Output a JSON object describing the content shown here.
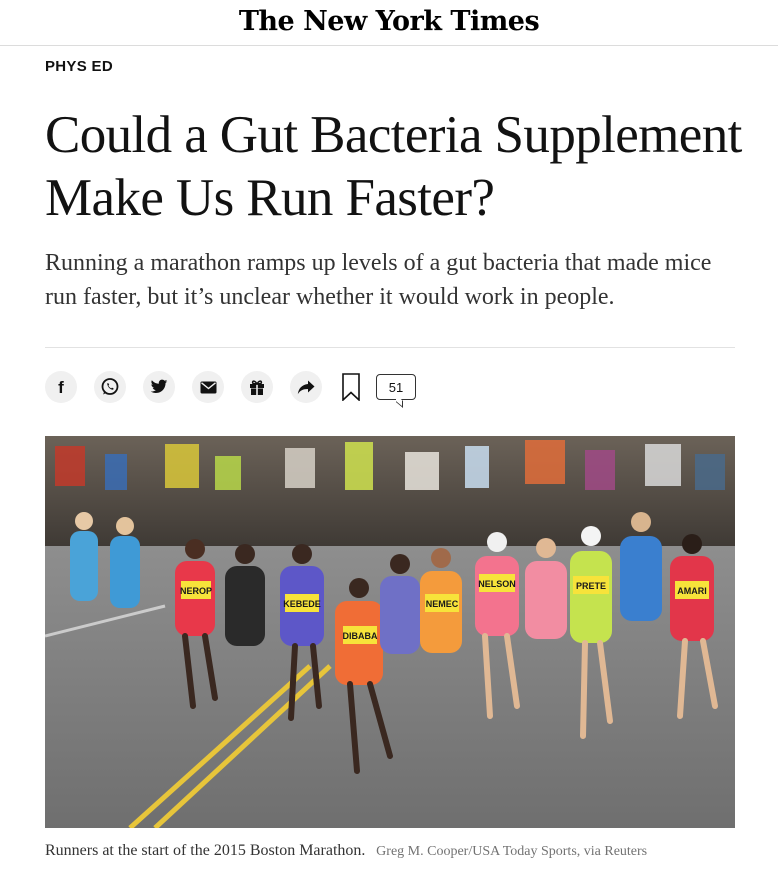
{
  "masthead": {
    "logo_text": "The New York Times"
  },
  "article": {
    "kicker": "PHYS ED",
    "headline": "Could a Gut Bacteria Supplement Make Us Run Faster?",
    "summary": "Running a marathon ramps up levels of a gut bacteria that made mice run faster, but it’s unclear whether it would work in people."
  },
  "share_bar": {
    "buttons": [
      {
        "icon": "facebook-icon",
        "glyph": "f"
      },
      {
        "icon": "whatsapp-icon"
      },
      {
        "icon": "twitter-icon"
      },
      {
        "icon": "email-icon"
      },
      {
        "icon": "gift-icon"
      },
      {
        "icon": "share-arrow-icon"
      }
    ],
    "bookmark_icon": "bookmark-icon",
    "comment_count": "51"
  },
  "photo": {
    "bibs": [
      "NEROP",
      "KEBEDE",
      "DIBABA",
      "NEMEC",
      "NELSON",
      "PRETE",
      "AMARI"
    ],
    "caption": "Runners at the start of the 2015 Boston Marathon.",
    "credit": "Greg M. Cooper/USA Today Sports, via Reuters"
  },
  "colors": {
    "text": "#121212",
    "divider": "#e2e2e2",
    "icon_bg": "#f0f0f0",
    "credit": "#727272"
  }
}
